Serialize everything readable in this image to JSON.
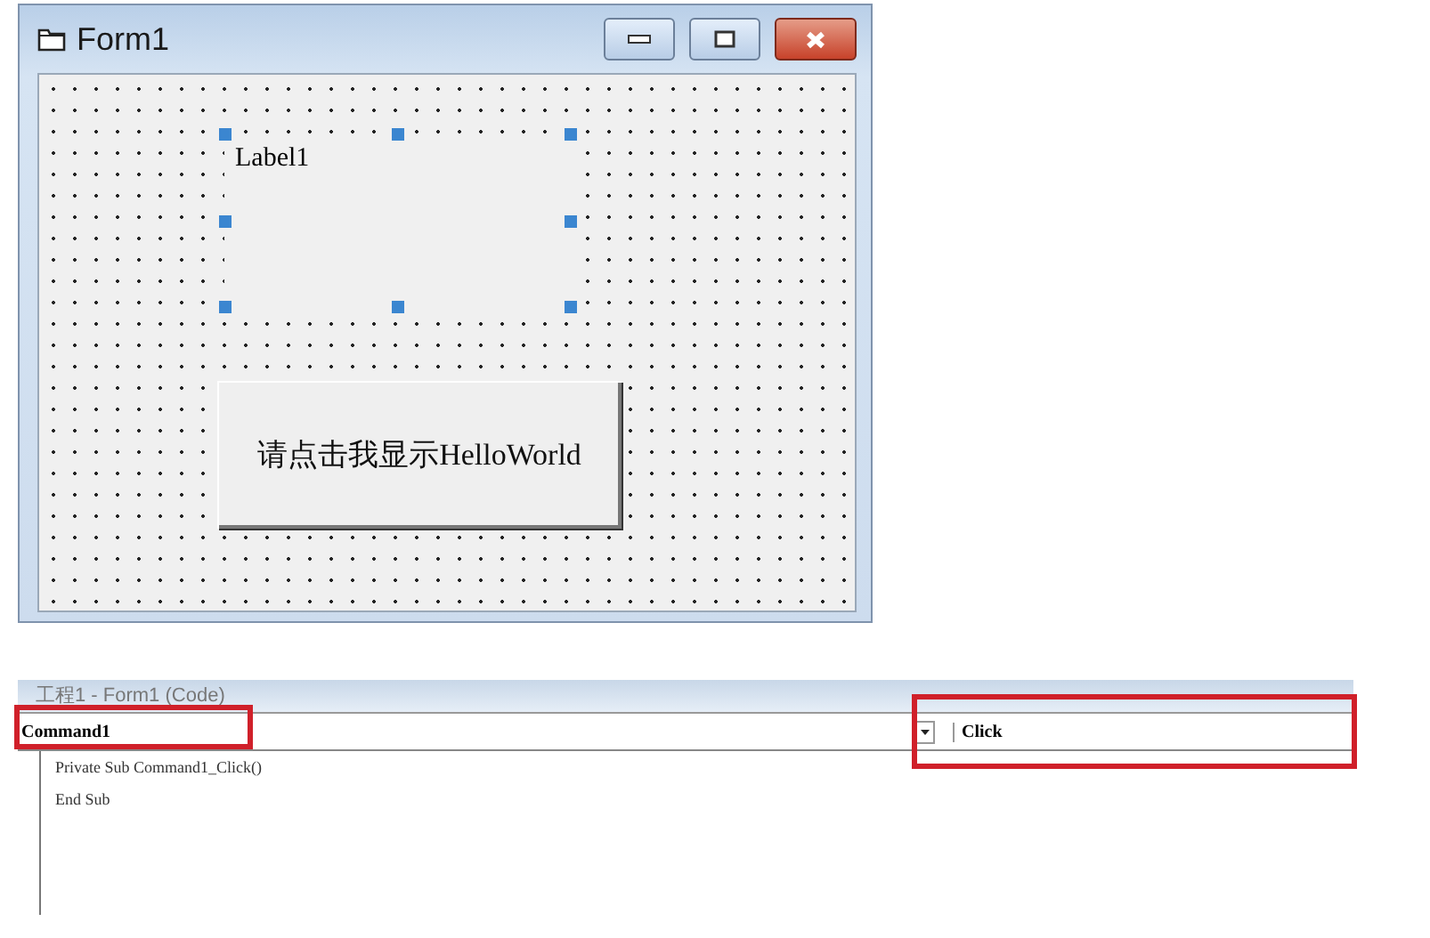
{
  "form_window": {
    "title": "Form1",
    "controls": [
      {
        "kind": "label",
        "text": "Label1",
        "selected": true
      },
      {
        "kind": "button",
        "text": "请点击我显示HelloWorld",
        "selected": false
      }
    ]
  },
  "code_window": {
    "title": "工程1 - Form1 (Code)",
    "object_combo": {
      "value": "Command1",
      "highlighted": true
    },
    "procedure_combo": {
      "value": "Click",
      "highlighted": true
    },
    "code_lines": [
      "Private Sub Command1_Click()",
      "End Sub"
    ]
  }
}
